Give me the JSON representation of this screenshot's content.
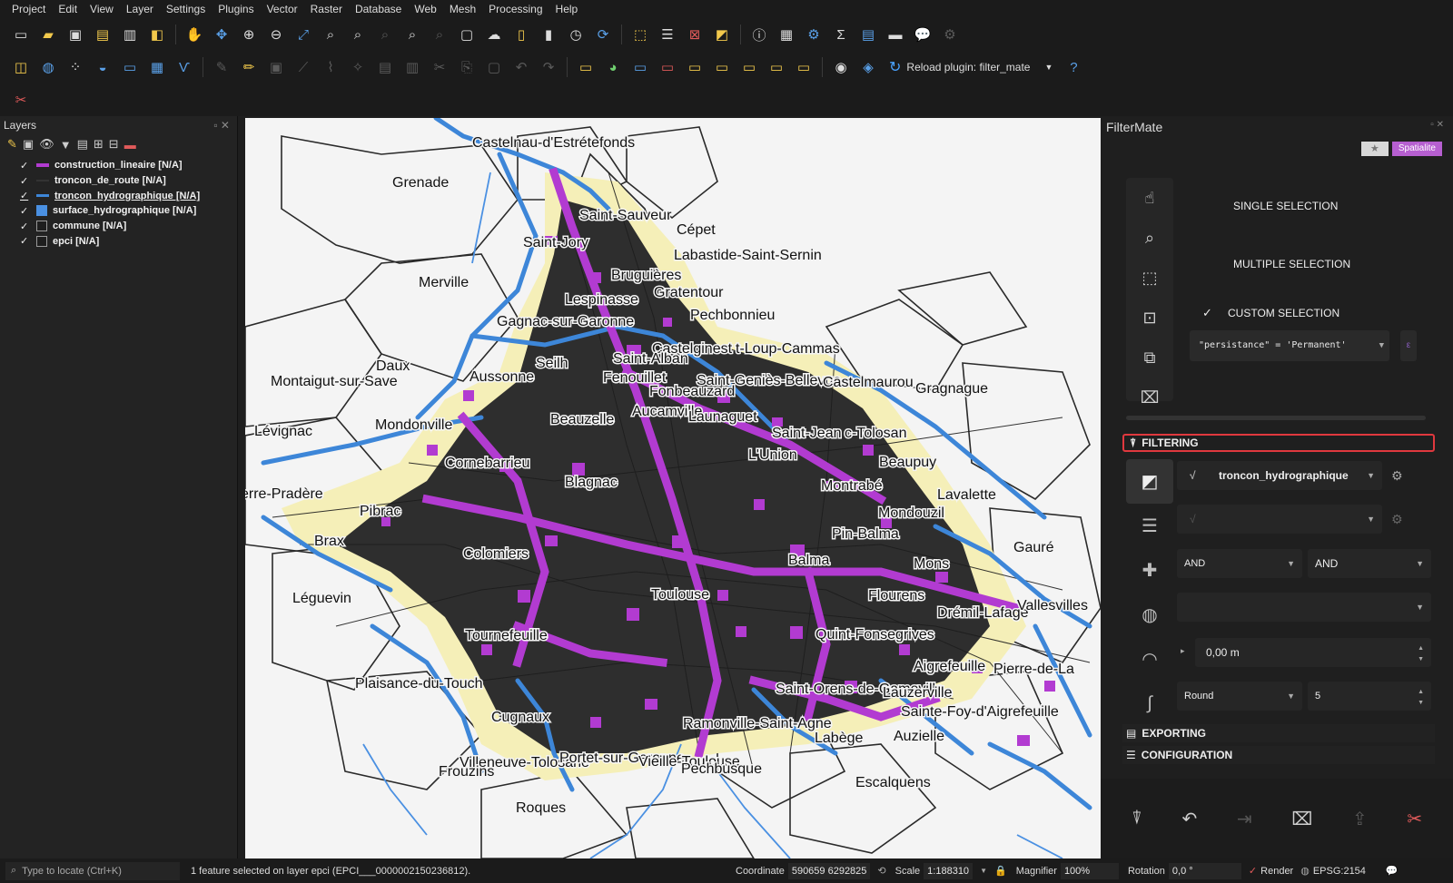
{
  "menu": [
    "Project",
    "Edit",
    "View",
    "Layer",
    "Settings",
    "Plugins",
    "Vector",
    "Raster",
    "Database",
    "Web",
    "Mesh",
    "Processing",
    "Help"
  ],
  "toolbar2": {
    "reload_label": "Reload plugin: filter_mate"
  },
  "layers_panel": {
    "title": "Layers",
    "items": [
      {
        "label": "construction_lineaire [N/A]",
        "checked": "✓",
        "symbol_color": "#b23bd1",
        "symbol": "line"
      },
      {
        "label": "troncon_de_route [N/A]",
        "checked": "✓",
        "symbol_color": "#333333",
        "symbol": "line"
      },
      {
        "label": "troncon_hydrographique [N/A]",
        "checked": "✓",
        "symbol_color": "#3d86d8",
        "symbol": "line"
      },
      {
        "label": "surface_hydrographique [N/A]",
        "checked": "✓",
        "symbol_color": "#4a90e2",
        "symbol": "fill"
      },
      {
        "label": "commune [N/A]",
        "checked": "✓",
        "symbol_color": "#ffffff",
        "symbol": "outline"
      },
      {
        "label": "epci [N/A]",
        "checked": "✓",
        "symbol_color": "#ffffff",
        "symbol": "outline"
      }
    ]
  },
  "map": {
    "towns": [
      "Castelnau-d'Estrétefonds",
      "Grenade",
      "Saint-Sauveur",
      "Cépet",
      "Saint-Jory",
      "Labastide-Saint-Sernin",
      "Bruguières",
      "Merville",
      "Lespinasse",
      "Gratentour",
      "Gagnac-sur-Garonne",
      "Pechbonnieu",
      "Castelginest",
      "t-Loup-Cammas",
      "Saint-Alban",
      "Seilh",
      "Daux",
      "Montaigut-sur-Save",
      "Aussonne",
      "Fenouillet",
      "Saint-Geniès-Bellevue",
      "Castelmaurou",
      "Gragnague",
      "Fonbeauzard",
      "Aucamville",
      "Launaguet",
      "Lévignac",
      "Mondonville",
      "Beauzelle",
      "Saint-Jean",
      "c-Tolosan",
      "L'Union",
      "Cornebarrieu",
      "Beaupuy",
      "Blagnac",
      "Montrabé",
      "Lavalette",
      "erre-Pradère",
      "Pibrac",
      "Mondouzil",
      "Pin-Balma",
      "Brax",
      "Colomiers",
      "Gauré",
      "Balma",
      "Mons",
      "Léguevin",
      "Toulouse",
      "Flourens",
      "Drémil-Lafage",
      "Vallesvilles",
      "Tournefeuille",
      "Quint-Fonsegrives",
      "Aigrefeuille",
      "Pierre-de-La",
      "Plaisance-du-Touch",
      "Saint-Orens-de-Gameville",
      "Lauzerville",
      "Sainte-Foy-d'Aigrefeuille",
      "Cugnaux",
      "Ramonville-Saint-Agne",
      "Labège",
      "Auzielle",
      "Villeneuve-Tolosane",
      "Portet-sur-Garonne",
      "Vieille-Toulouse",
      "Frouzins",
      "Pechbusque",
      "Escalquens",
      "Roques"
    ]
  },
  "filtermate": {
    "title": "FilterMate",
    "badge_star": "★",
    "badge_backend": "Spatialite",
    "single_selection": "SINGLE SELECTION",
    "multiple_selection": "MULTIPLE SELECTION",
    "custom_selection": "CUSTOM SELECTION",
    "custom_checked": "✓",
    "expression": "\"persistance\" = 'Permanent'",
    "filtering_label": "FILTERING",
    "source_layer": "troncon_hydrographique",
    "combine_op_1": "AND",
    "combine_op_2": "AND",
    "buffer_value": "0,00 m",
    "cap_style": "Round",
    "segments": "5",
    "exporting_label": "EXPORTING",
    "configuration_label": "CONFIGURATION"
  },
  "statusbar": {
    "locate_placeholder": "Type to locate (Ctrl+K)",
    "message": "1 feature selected on layer epci (EPCI___0000002150236812).",
    "coordinate_label": "Coordinate",
    "coordinate_value": "590659  6292825",
    "scale_label": "Scale",
    "scale_value": "1:188310",
    "magnifier_label": "Magnifier",
    "magnifier_value": "100%",
    "rotation_label": "Rotation",
    "rotation_value": "0,0 °",
    "render_label": "Render",
    "render_checked": "✓",
    "crs": "EPSG:2154"
  },
  "colors": {
    "accent_red": "#e0383e",
    "spatialite_purple": "#b65fd0",
    "feature_purple": "#b23bd1",
    "water_blue": "#3d86d8",
    "urban_fill": "#f5efb8"
  }
}
